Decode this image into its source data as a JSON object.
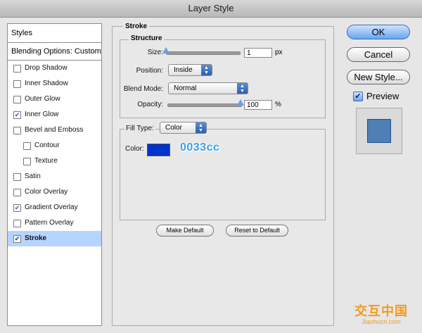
{
  "window": {
    "title": "Layer Style"
  },
  "styles_panel": {
    "header": "Styles",
    "blending_options": "Blending Options: Custom",
    "items": [
      {
        "label": "Drop Shadow",
        "checked": false,
        "indent": false,
        "selected": false
      },
      {
        "label": "Inner Shadow",
        "checked": false,
        "indent": false,
        "selected": false
      },
      {
        "label": "Outer Glow",
        "checked": false,
        "indent": false,
        "selected": false
      },
      {
        "label": "Inner Glow",
        "checked": true,
        "indent": false,
        "selected": false
      },
      {
        "label": "Bevel and Emboss",
        "checked": false,
        "indent": false,
        "selected": false
      },
      {
        "label": "Contour",
        "checked": false,
        "indent": true,
        "selected": false
      },
      {
        "label": "Texture",
        "checked": false,
        "indent": true,
        "selected": false
      },
      {
        "label": "Satin",
        "checked": false,
        "indent": false,
        "selected": false
      },
      {
        "label": "Color Overlay",
        "checked": false,
        "indent": false,
        "selected": false
      },
      {
        "label": "Gradient Overlay",
        "checked": true,
        "indent": false,
        "selected": false
      },
      {
        "label": "Pattern Overlay",
        "checked": false,
        "indent": false,
        "selected": false
      },
      {
        "label": "Stroke",
        "checked": true,
        "indent": false,
        "selected": true
      }
    ]
  },
  "stroke": {
    "group_title": "Stroke",
    "structure_title": "Structure",
    "size_label": "Size:",
    "size_value": "1",
    "size_unit": "px",
    "size_fraction": 0.0,
    "position_label": "Position:",
    "position_value": "Inside",
    "blend_label": "Blend Mode:",
    "blend_value": "Normal",
    "opacity_label": "Opacity:",
    "opacity_value": "100",
    "opacity_unit": "%",
    "opacity_fraction": 1.0,
    "fill_type_label": "Fill Type:",
    "fill_type_value": "Color",
    "color_label": "Color:",
    "color_hex": "#0033cc",
    "color_annotation": "0033cc",
    "make_default": "Make Default",
    "reset_default": "Reset to Default"
  },
  "buttons": {
    "ok": "OK",
    "cancel": "Cancel",
    "new_style": "New Style...",
    "preview_label": "Preview",
    "preview_checked": true
  },
  "watermark": {
    "main": "交互中国",
    "sub": "Jiaohucn.com"
  },
  "colors": {
    "accent": "#3a6fb8",
    "selection": "#b5d4ff",
    "watermark": "#f39a1e"
  }
}
